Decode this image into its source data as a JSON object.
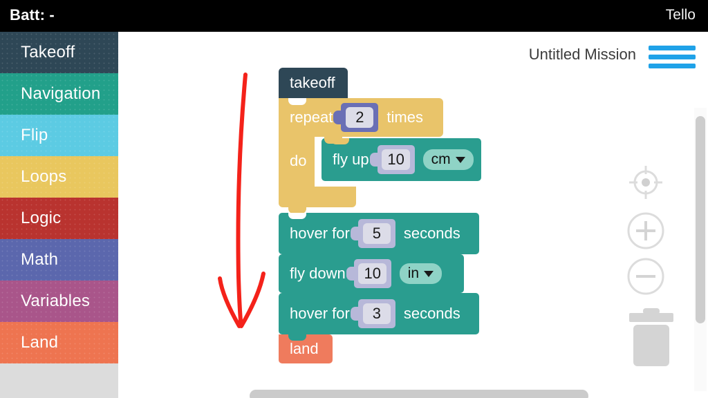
{
  "status_bar": {
    "battery_label": "Batt: -",
    "app_title": "Tello",
    "background": "#000000"
  },
  "sidebar": {
    "items": [
      {
        "label": "Takeoff",
        "color": "#2e4756"
      },
      {
        "label": "Navigation",
        "color": "#22a08a"
      },
      {
        "label": "Flip",
        "color": "#5ccbe3"
      },
      {
        "label": "Loops",
        "color": "#e9c75e"
      },
      {
        "label": "Logic",
        "color": "#b9332f"
      },
      {
        "label": "Math",
        "color": "#5b67ad"
      },
      {
        "label": "Variables",
        "color": "#a9558a"
      },
      {
        "label": "Land",
        "color": "#ee7450"
      }
    ],
    "filler_color": "#dcdcdc"
  },
  "workspace": {
    "mission_title": "Untitled Mission",
    "menu_icon": "hamburger-menu-icon",
    "menu_color": "#1fa2e8",
    "controls": [
      {
        "name": "center-target-icon"
      },
      {
        "name": "zoom-in-icon",
        "label": "+"
      },
      {
        "name": "zoom-out-icon",
        "label": "−"
      }
    ],
    "trash_icon": "trash-can-icon",
    "annotation": {
      "name": "red-arrow-annotation",
      "color": "#f4221a"
    }
  },
  "blocks": {
    "takeoff": {
      "label": "takeoff",
      "color": "#2e4756"
    },
    "repeat": {
      "label": "repeat",
      "value": "2",
      "suffix": "times",
      "do_label": "do",
      "color": "#e9c46a"
    },
    "fly_up": {
      "label": "fly up",
      "value": "10",
      "unit": "cm",
      "color": "#2a9d8f"
    },
    "hover_1": {
      "label": "hover for",
      "value": "5",
      "suffix": "seconds",
      "color": "#2a9d8f"
    },
    "fly_down": {
      "label": "fly down",
      "value": "10",
      "unit": "in",
      "color": "#2a9d8f"
    },
    "hover_2": {
      "label": "hover for",
      "value": "3",
      "suffix": "seconds",
      "color": "#2a9d8f"
    },
    "land": {
      "label": "land",
      "color": "#ef7b5d"
    }
  }
}
